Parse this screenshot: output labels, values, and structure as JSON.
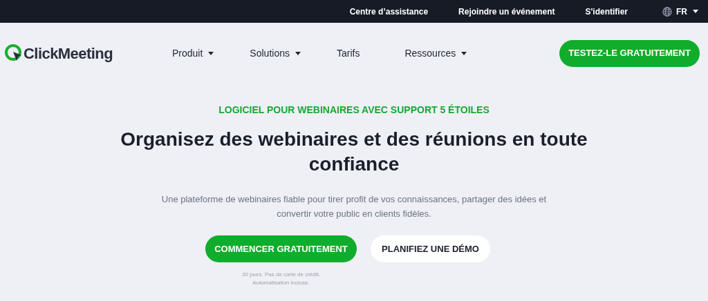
{
  "top_bar": {
    "links": [
      "Centre d’assistance",
      "Rejoindre un événement",
      "S'identifier"
    ],
    "language": "FR"
  },
  "nav": {
    "logo": "ClickMeeting",
    "items": [
      {
        "label": "Produit",
        "dropdown": true
      },
      {
        "label": "Solutions",
        "dropdown": true
      },
      {
        "label": "Tarifs",
        "dropdown": false
      },
      {
        "label": "Ressources",
        "dropdown": true
      }
    ],
    "cta": "TESTEZ-LE GRATUITEMENT"
  },
  "hero": {
    "eyebrow": "LOGICIEL POUR WEBINAIRES AVEC SUPPORT 5 ÉTOILES",
    "title": "Organisez des webinaires et des réunions en toute confiance",
    "subtitle": "Une plateforme de webinaires fiable pour tirer profit de vos connaissances, partager des idées et convertir votre public en clients fidèles.",
    "primary_button": "COMMENCER GRATUITEMENT",
    "secondary_button": "PLANIFIEZ UNE DÉMO",
    "note": [
      "30 jours. Pas de carte de crédit.",
      "Automatisation incluse."
    ]
  }
}
